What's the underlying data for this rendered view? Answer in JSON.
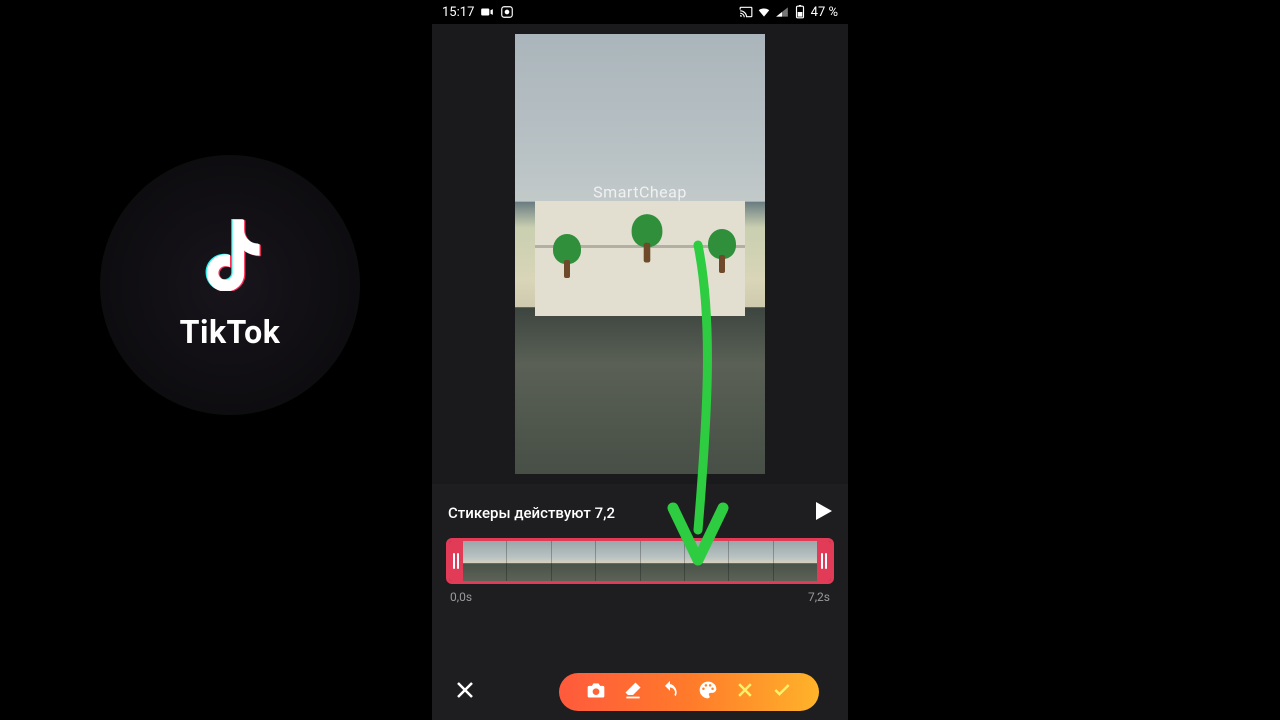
{
  "status_bar": {
    "time": "15:17",
    "battery_text": "47 %"
  },
  "tiktok": {
    "label": "TikTok"
  },
  "preview": {
    "watermark": "SmartCheap"
  },
  "editor": {
    "sticker_label": "Стикеры действуют 7,2",
    "time_start": "0,0s",
    "time_end": "7,2s"
  }
}
